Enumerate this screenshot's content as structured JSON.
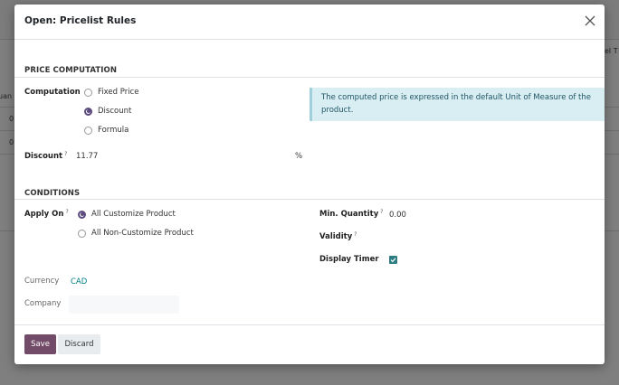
{
  "background": {
    "col_header": "uan",
    "col_header_right": "el T",
    "row_values": [
      "0",
      "0"
    ]
  },
  "modal": {
    "title": "Open: Pricelist Rules",
    "close_icon": "close-icon"
  },
  "price_computation": {
    "section_title": "PRICE COMPUTATION",
    "computation_label": "Computation",
    "options": [
      {
        "label": "Fixed Price",
        "checked": false
      },
      {
        "label": "Discount",
        "checked": true
      },
      {
        "label": "Formula",
        "checked": false
      }
    ],
    "info_text": "The computed price is expressed in the default Unit of Measure of the product.",
    "discount_label": "Discount",
    "discount_value": "11.77",
    "discount_unit": "%"
  },
  "conditions": {
    "section_title": "CONDITIONS",
    "apply_on_label": "Apply On",
    "apply_on_options": [
      {
        "label": "All Customize Product",
        "checked": true
      },
      {
        "label": "All Non-Customize Product",
        "checked": false
      }
    ],
    "min_quantity_label": "Min. Quantity",
    "min_quantity_value": "0.00",
    "validity_label": "Validity",
    "display_timer_label": "Display Timer",
    "display_timer_checked": true,
    "currency_label": "Currency",
    "currency_value": "CAD",
    "company_label": "Company",
    "company_value": ""
  },
  "footer": {
    "save_label": "Save",
    "discard_label": "Discard"
  },
  "colors": {
    "primary": "#714b67",
    "checkbox": "#2e7d83",
    "info_bg": "#d8eef3",
    "link": "#017e84"
  },
  "tooltip_mark": "?"
}
